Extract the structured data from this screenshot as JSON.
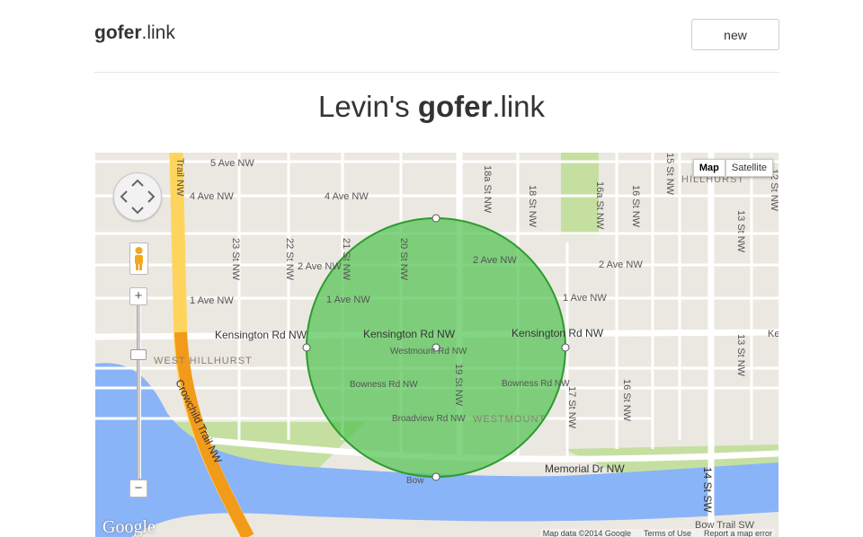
{
  "header": {
    "logo_bold": "gofer",
    "logo_light": ".link",
    "new_label": "new"
  },
  "page": {
    "title_prefix": "Levin's ",
    "title_bold": "gofer",
    "title_light": ".link"
  },
  "map": {
    "type_controls": {
      "map_label": "Map",
      "satellite_label": "Satellite",
      "active": "Map"
    },
    "zoom_in_label": "+",
    "zoom_out_label": "−",
    "google_label": "Google",
    "footer": {
      "data_label": "Map data ©2014 Google",
      "terms_label": "Terms of Use",
      "report_label": "Report a map error"
    },
    "colors": {
      "land": "#ebe8e1",
      "street": "#ffffff",
      "arterial": "#ffd45c",
      "highway": "#f29a1a",
      "water": "#8ab4f8",
      "park": "#c5dfa1",
      "circle_fill": "#4fc24f",
      "circle_stroke": "#2d9b2d"
    },
    "labels": {
      "ave5": "5 Ave NW",
      "ave4": "4 Ave NW",
      "ave2_left": "2 Ave NW",
      "ave2_mid": "2 Ave NW",
      "ave2_right": "2 Ave NW",
      "ave1_left": "1 Ave NW",
      "ave1_mid": "1 Ave NW",
      "ave1_right": "1 Ave NW",
      "kens_left": "Kensington Rd NW",
      "kens_mid": "Kensington Rd NW",
      "kens_right": "Kensington Rd NW",
      "westmount_rd": "Westmount Rd NW",
      "bowness_left": "Bowness Rd NW",
      "bowness_right": "Bowness Rd NW",
      "broadview": "Broadview Rd NW",
      "memorial": "Memorial Dr NW",
      "bow": "Bow",
      "bow_trail": "Bow Trail SW",
      "trail_nw": "Trail NW",
      "crowchild": "Crowchild Trail NW",
      "st23": "23 St NW",
      "st22": "22 St NW",
      "st21": "21 St NW",
      "st20": "20 St NW",
      "st19": "19 St NW",
      "st18a": "18a St NW",
      "st18": "18 St NW",
      "st17": "17 St NW",
      "st16a": "16a St NW",
      "st16": "16 St NW",
      "st15": "15 St NW",
      "st14": "14 St SW",
      "st13_top": "13 St NW",
      "st13_bot": "13 St NW",
      "st12": "12 St NW",
      "west_hillhurst": "WEST HILLHURST",
      "hillhurst": "HILLHURST",
      "westmount": "WESTMOUNT",
      "edge_e": "Ke"
    }
  }
}
